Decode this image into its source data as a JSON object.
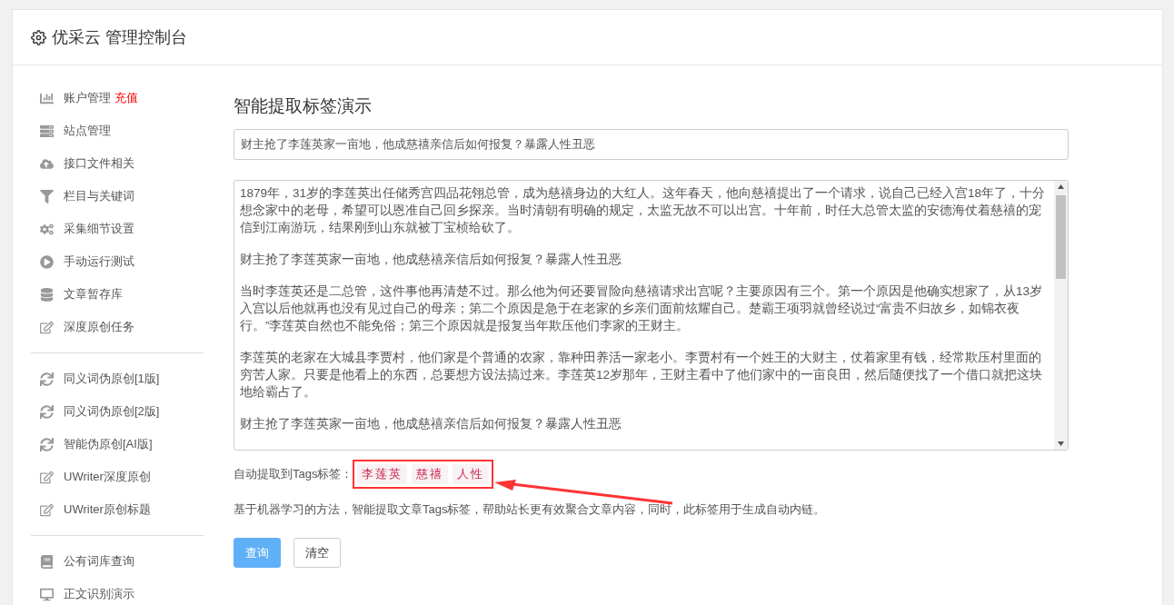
{
  "header": {
    "title": "优采云 管理控制台"
  },
  "sidebar": {
    "groups": [
      [
        {
          "label": "账户管理",
          "badge": "充值"
        },
        {
          "label": "站点管理"
        },
        {
          "label": "接口文件相关"
        },
        {
          "label": "栏目与关键词"
        },
        {
          "label": "采集细节设置"
        },
        {
          "label": "手动运行测试"
        },
        {
          "label": "文章暂存库"
        },
        {
          "label": "深度原创任务"
        }
      ],
      [
        {
          "label": "同义词伪原创[1版]"
        },
        {
          "label": "同义词伪原创[2版]"
        },
        {
          "label": "智能伪原创[AI版]"
        },
        {
          "label": "UWriter深度原创"
        },
        {
          "label": "UWriter原创标题"
        }
      ],
      [
        {
          "label": "公有词库查询"
        },
        {
          "label": "正文识别演示"
        }
      ]
    ]
  },
  "main": {
    "title": "智能提取标签演示",
    "title_input": {
      "value": "财主抢了李莲英家一亩地，他成慈禧亲信后如何报复？暴露人性丑恶"
    },
    "content": {
      "paragraphs": [
        "1879年，31岁的李莲英出任储秀宫四品花翎总管，成为慈禧身边的大红人。这年春天，他向慈禧提出了一个请求，说自己已经入宫18年了，十分想念家中的老母，希望可以恩准自己回乡探亲。当时清朝有明确的规定，太监无故不可以出宫。十年前，时任大总管太监的安德海仗着慈禧的宠信到江南游玩，结果刚到山东就被丁宝桢给砍了。",
        "财主抢了李莲英家一亩地，他成慈禧亲信后如何报复？暴露人性丑恶",
        "当时李莲英还是二总管，这件事他再清楚不过。那么他为何还要冒险向慈禧请求出宫呢？主要原因有三个。第一个原因是他确实想家了，从13岁入宫以后他就再也没有见过自己的母亲；第二个原因是急于在老家的乡亲们面前炫耀自己。楚霸王项羽就曾经说过“富贵不归故乡，如锦衣夜行。”李莲英自然也不能免俗；第三个原因就是报复当年欺压他们李家的王财主。",
        "李莲英的老家在大城县李贾村，他们家是个普通的农家，靠种田养活一家老小。李贾村有一个姓王的大财主，仗着家里有钱，经常欺压村里面的穷苦人家。只要是他看上的东西，总要想方设法搞过来。李莲英12岁那年，王财主看中了他们家中的一亩良田，然后随便找了一个借口就把这块地给霸占了。",
        "财主抢了李莲英家一亩地，他成慈禧亲信后如何报复？暴露人性丑恶"
      ]
    },
    "tags_label": "自动提取到Tags标签：",
    "tags": [
      "李莲英",
      "慈禧",
      "人性"
    ],
    "description": "基于机器学习的方法，智能提取文章Tags标签，帮助站长更有效聚合文章内容，同时，此标签用于生成自动内链。",
    "buttons": [
      {
        "label": "查询",
        "kind": "primary"
      },
      {
        "label": "清空",
        "kind": "default"
      }
    ]
  }
}
